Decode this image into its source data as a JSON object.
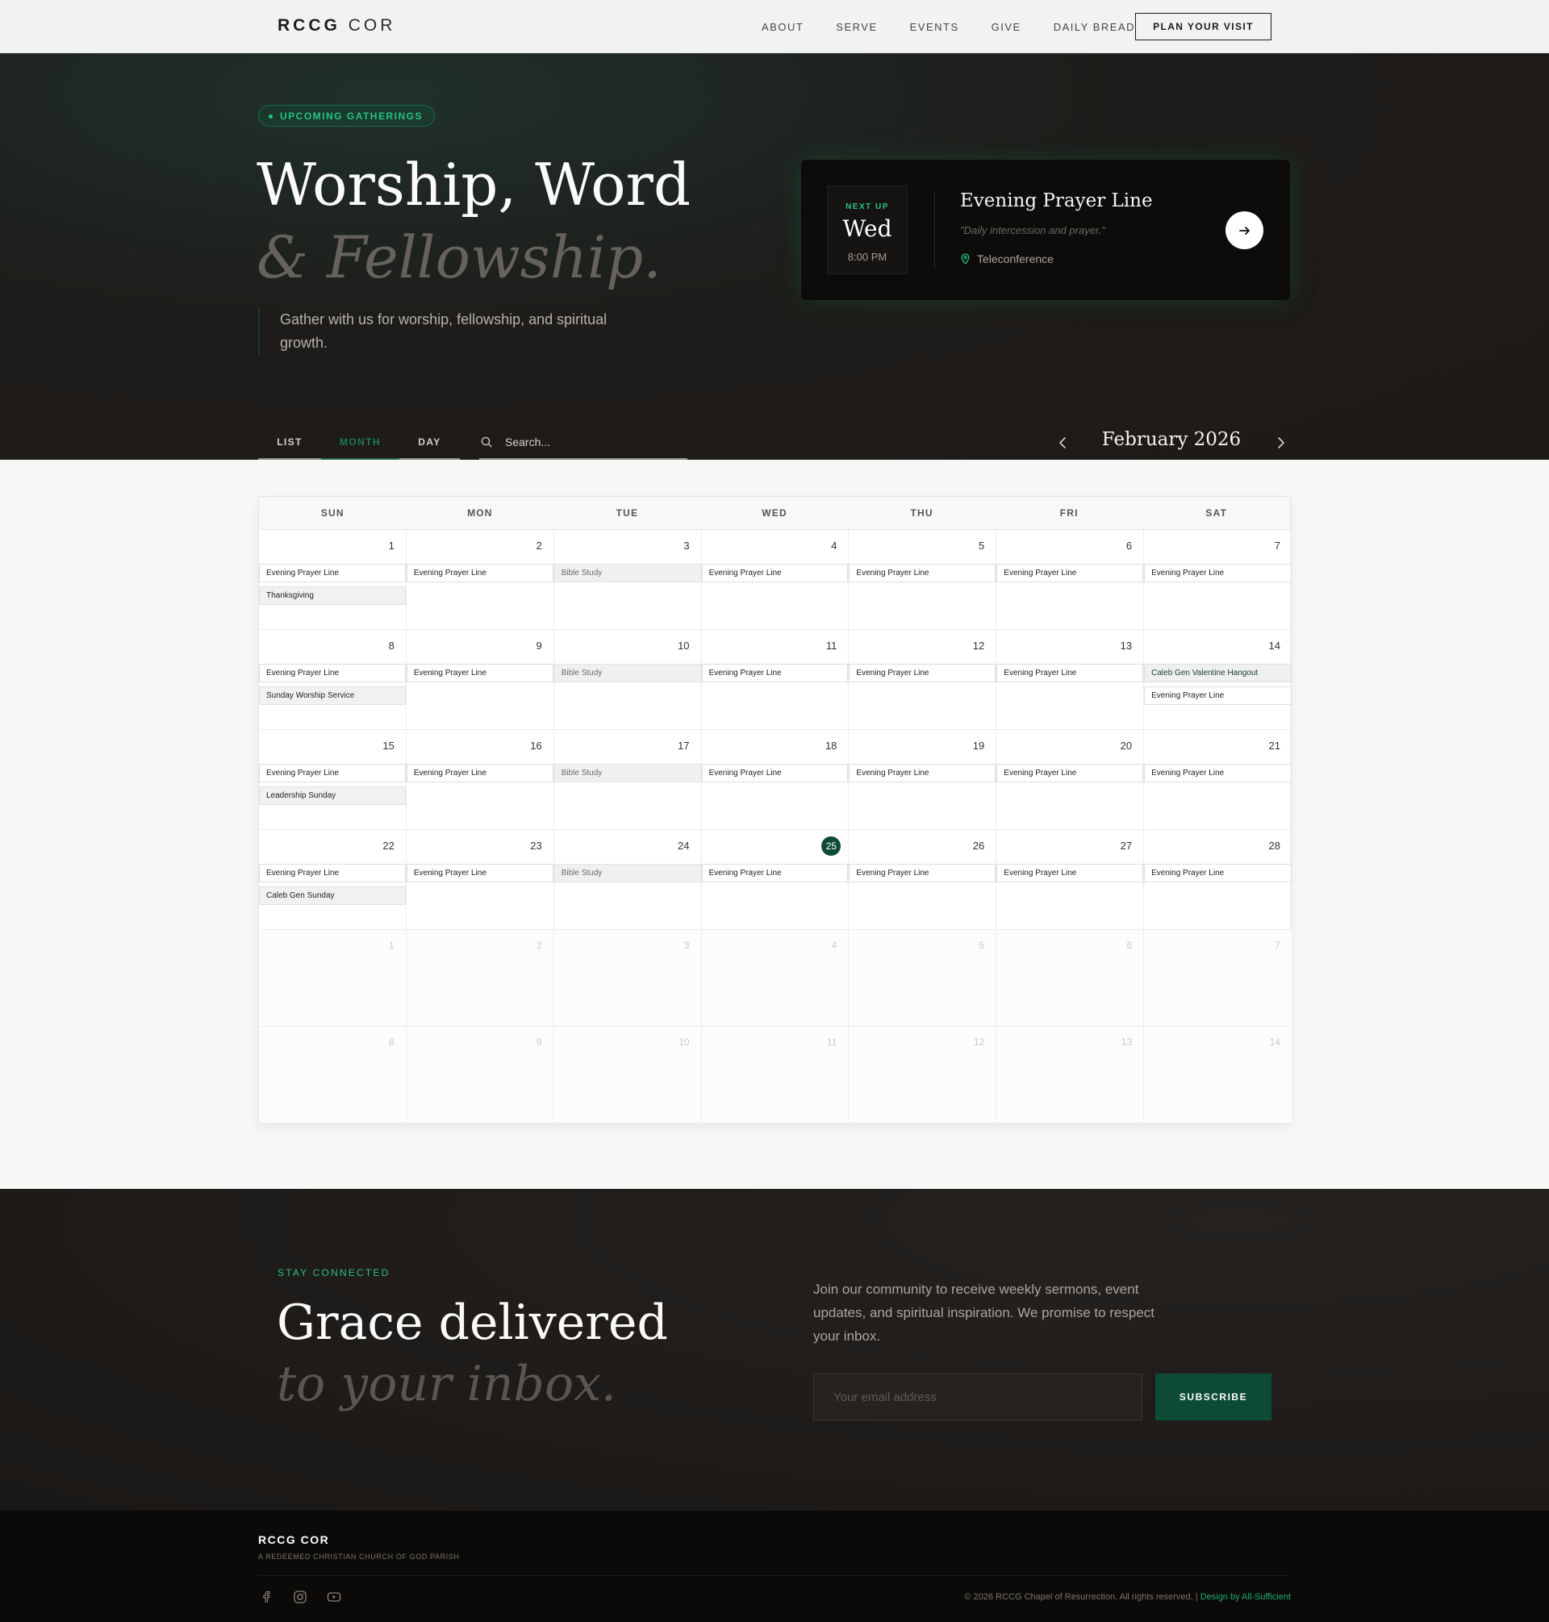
{
  "nav": {
    "logo_bold": "RCCG",
    "logo_light": "COR",
    "links": [
      "ABOUT",
      "SERVE",
      "EVENTS",
      "GIVE",
      "DAILY BREAD"
    ],
    "cta": "PLAN YOUR VISIT"
  },
  "hero": {
    "badge": "UPCOMING GATHERINGS",
    "title_line1": "Worship, Word",
    "title_line2": "& Fellowship.",
    "subtitle": "Gather with us for worship, fellowship, and spiritual growth.",
    "next_up": {
      "label": "NEXT UP",
      "day": "Wed",
      "time": "8:00 PM",
      "title": "Evening Prayer Line",
      "description": "\"Daily intercession and prayer.\"",
      "location": "Teleconference"
    }
  },
  "toolbar": {
    "tabs": [
      "LIST",
      "MONTH",
      "DAY"
    ],
    "active_tab": "MONTH",
    "search_placeholder": "Search...",
    "month_label": "February 2026"
  },
  "calendar": {
    "weekdays": [
      "SUN",
      "MON",
      "TUE",
      "WED",
      "THU",
      "FRI",
      "SAT"
    ],
    "today": 25,
    "weeks": [
      [
        {
          "day": "1",
          "events": [
            "Evening Prayer Line",
            "Thanksgiving"
          ]
        },
        {
          "day": "2",
          "events": [
            "Evening Prayer Line"
          ]
        },
        {
          "day": "3",
          "events": [
            "Bible Study"
          ]
        },
        {
          "day": "4",
          "events": [
            "Evening Prayer Line"
          ]
        },
        {
          "day": "5",
          "events": [
            "Evening Prayer Line"
          ]
        },
        {
          "day": "6",
          "events": [
            "Evening Prayer Line"
          ]
        },
        {
          "day": "7",
          "events": [
            "Evening Prayer Line"
          ]
        }
      ],
      [
        {
          "day": "8",
          "events": [
            "Evening Prayer Line",
            "Sunday Worship Service"
          ]
        },
        {
          "day": "9",
          "events": [
            "Evening Prayer Line"
          ]
        },
        {
          "day": "10",
          "events": [
            "Bible Study"
          ]
        },
        {
          "day": "11",
          "events": [
            "Evening Prayer Line"
          ]
        },
        {
          "day": "12",
          "events": [
            "Evening Prayer Line"
          ]
        },
        {
          "day": "13",
          "events": [
            "Evening Prayer Line"
          ]
        },
        {
          "day": "14",
          "events": [
            "Caleb Gen Valentine Hangout",
            "Evening Prayer Line"
          ]
        }
      ],
      [
        {
          "day": "15",
          "events": [
            "Evening Prayer Line",
            "Leadership Sunday"
          ]
        },
        {
          "day": "16",
          "events": [
            "Evening Prayer Line"
          ]
        },
        {
          "day": "17",
          "events": [
            "Bible Study"
          ]
        },
        {
          "day": "18",
          "events": [
            "Evening Prayer Line"
          ]
        },
        {
          "day": "19",
          "events": [
            "Evening Prayer Line"
          ]
        },
        {
          "day": "20",
          "events": [
            "Evening Prayer Line"
          ]
        },
        {
          "day": "21",
          "events": [
            "Evening Prayer Line"
          ]
        }
      ],
      [
        {
          "day": "22",
          "events": [
            "Evening Prayer Line",
            "Caleb Gen Sunday"
          ]
        },
        {
          "day": "23",
          "events": [
            "Evening Prayer Line"
          ]
        },
        {
          "day": "24",
          "events": [
            "Bible Study"
          ]
        },
        {
          "day": "25",
          "events": [
            "Evening Prayer Line"
          ]
        },
        {
          "day": "26",
          "events": [
            "Evening Prayer Line"
          ]
        },
        {
          "day": "27",
          "events": [
            "Evening Prayer Line"
          ]
        },
        {
          "day": "28",
          "events": [
            "Evening Prayer Line"
          ]
        }
      ],
      [
        {
          "day": "1",
          "other": true,
          "events": []
        },
        {
          "day": "2",
          "other": true,
          "events": []
        },
        {
          "day": "3",
          "other": true,
          "events": []
        },
        {
          "day": "4",
          "other": true,
          "events": []
        },
        {
          "day": "5",
          "other": true,
          "events": []
        },
        {
          "day": "6",
          "other": true,
          "events": []
        },
        {
          "day": "7",
          "other": true,
          "events": []
        }
      ],
      [
        {
          "day": "8",
          "other": true,
          "events": []
        },
        {
          "day": "9",
          "other": true,
          "events": []
        },
        {
          "day": "10",
          "other": true,
          "events": []
        },
        {
          "day": "11",
          "other": true,
          "events": []
        },
        {
          "day": "12",
          "other": true,
          "events": []
        },
        {
          "day": "13",
          "other": true,
          "events": []
        },
        {
          "day": "14",
          "other": true,
          "events": []
        }
      ]
    ]
  },
  "newsletter": {
    "kicker": "STAY CONNECTED",
    "title_line1": "Grace delivered",
    "title_line2": "to your inbox.",
    "text": "Join our community to receive weekly sermons, event updates, and spiritual inspiration. We promise to respect your inbox.",
    "email_placeholder": "Your email address",
    "button": "SUBSCRIBE"
  },
  "footer": {
    "logo": "RCCG COR",
    "tagline": "A REDEEMED CHRISTIAN CHURCH OF GOD PARISH",
    "social_icons": [
      "facebook-icon",
      "instagram-icon",
      "youtube-icon"
    ],
    "copyright": "© 2026 RCCG Chapel of Resurrection. All rights reserved. |",
    "credit": "Design by All-Sufficient"
  },
  "colors": {
    "accent": "#29c184",
    "accent_dark": "#0d4b36",
    "dark_bg": "#1e1c1a",
    "today_badge": "#0f4a36"
  }
}
